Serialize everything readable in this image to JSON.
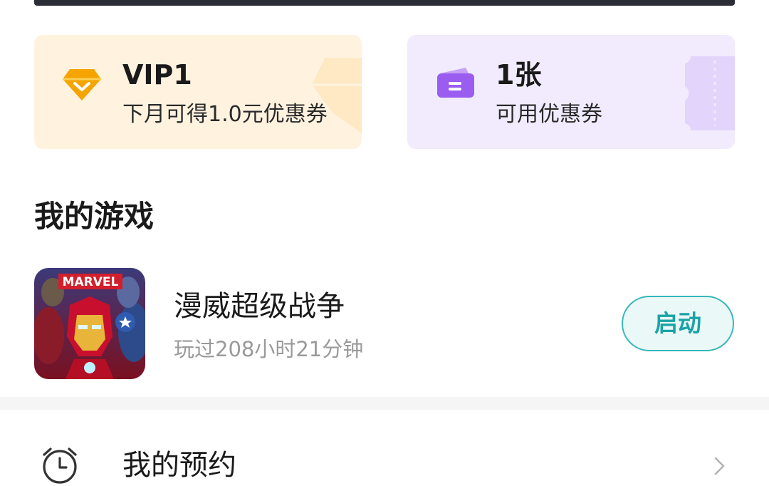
{
  "vip_card": {
    "title": "VIP1",
    "subtitle": "下月可得1.0元优惠券"
  },
  "coupon_card": {
    "title": "1张",
    "subtitle": "可用优惠券"
  },
  "my_games": {
    "section_title": "我的游戏",
    "games": [
      {
        "icon_text": "MARVEL",
        "name": "漫威超级战争",
        "play_time": "玩过208小时21分钟",
        "action_label": "启动"
      }
    ]
  },
  "menu": {
    "items": [
      {
        "label": "我的预约",
        "icon": "alarm-clock-icon"
      }
    ]
  },
  "colors": {
    "accent": "#1aa3a6",
    "vip_bg": "#fff3e0",
    "coupon_bg": "#f1ebfd",
    "vip_icon": "#f5a400",
    "coupon_icon": "#9b5cf0"
  }
}
